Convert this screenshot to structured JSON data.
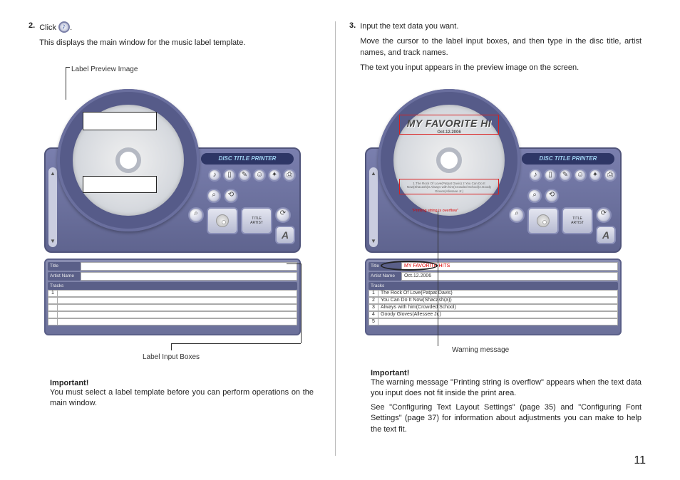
{
  "page_number": "11",
  "left": {
    "step_num": "2.",
    "click_word": "Click",
    "click_after": ".",
    "line2": "This displays the main window for the music label template.",
    "ann_preview": "Label Preview Image",
    "ann_inputs": "Label Input Boxes",
    "important": "Important!",
    "important_body": "You must select a label template before you can perform operations on the main window.",
    "app": {
      "header": "DISC TITLE PRINTER",
      "rail_up": "▲",
      "rail_down": "▼",
      "labels": {
        "title": "Title",
        "artist": "Artist Name",
        "tracks": "Tracks"
      },
      "track_nums": [
        "1"
      ],
      "panel_btn_label_line1": "TITLE",
      "panel_btn_label_line2": "ARTIST",
      "fmt_btn": "A"
    }
  },
  "right": {
    "step_num": "3.",
    "line1": "Input the text data you want.",
    "line2": "Move the cursor to the label input boxes, and then type in the disc title, artist names, and track names.",
    "line3": "The text you input appears in the preview image on the screen.",
    "ann_warning": "Warning message",
    "important": "Important!",
    "important_body1": "The warning message \"Printing string is overflow\" appears when the text data you input does not fit inside the print area.",
    "important_body2": "See \"Configuring Text Layout Settings\" (page 35) and \"Configuring Font Settings\" (page 37) for information about adjustments you can make to help the text fit.",
    "app": {
      "header": "DISC TITLE PRINTER",
      "disc_title": "MY FAVORITE HI",
      "disc_sub": "Oct.12.2006",
      "disc_tracks": "1.The Rock Of Love(Patpat Davis) 2.You Can Do It Now(Shacash)3.Always with him(Crowded School)4.Goody Gloves(Allessee Jr.)",
      "warning_msg": "\"Printing string is overflow\"",
      "rail_up": "▲",
      "rail_down": "▼",
      "labels": {
        "title": "Title",
        "artist": "Artist Name",
        "tracks": "Tracks"
      },
      "title_value": "MY FAVORITE HITS",
      "artist_value": "Oct.12.2006",
      "tracks": [
        {
          "n": "1",
          "t": "The Rock Of Love(Patpat Davis)"
        },
        {
          "n": "2",
          "t": "You Can Do It Now(Shacash(a))"
        },
        {
          "n": "3",
          "t": "Always with him(Crowded School)"
        },
        {
          "n": "4",
          "t": "Goody Gloves(Allessee Jr.)"
        },
        {
          "n": "5",
          "t": ""
        }
      ],
      "panel_btn_label_line1": "TITLE",
      "panel_btn_label_line2": "ARTIST",
      "fmt_btn": "A"
    }
  }
}
